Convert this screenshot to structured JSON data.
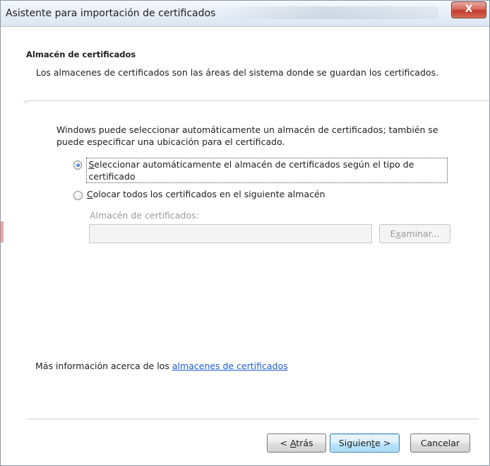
{
  "window": {
    "title": "Asistente para importación de certificados",
    "close_glyph": "X"
  },
  "header": {
    "title": "Almacén de certificados",
    "description": "Los almacenes de certificados son las áreas del sistema donde se guardan los certificados."
  },
  "body": {
    "intro": "Windows puede seleccionar automáticamente un almacén de certificados; también se puede especificar una ubicación para el certificado.",
    "options": [
      {
        "accel": "S",
        "label_rest": "eleccionar automáticamente el almacén de certificados según el tipo de certificado",
        "checked": true
      },
      {
        "accel": "C",
        "label_rest": "olocar todos los certificados en el siguiente almacén",
        "checked": false
      }
    ],
    "store_label": "Almacén de certificados:",
    "store_value": "",
    "browse_button": {
      "pre": "E",
      "accel": "x",
      "post": "aminar..."
    }
  },
  "more_info": {
    "prefix": "Más información acerca de los ",
    "link_text": "almacenes de certificados"
  },
  "footer": {
    "back": {
      "pre": "< ",
      "accel": "A",
      "post": "trás"
    },
    "next": {
      "pre": "Siguien",
      "accel": "t",
      "post": "e >"
    },
    "cancel": "Cancelar"
  },
  "colors": {
    "link": "#1b5dcf",
    "close_button": "#c2392a",
    "default_button_border": "#3c7fb1"
  },
  "icons": {
    "close": "close-icon",
    "radio_checked": "radio-checked-icon",
    "radio_unchecked": "radio-unchecked-icon"
  }
}
